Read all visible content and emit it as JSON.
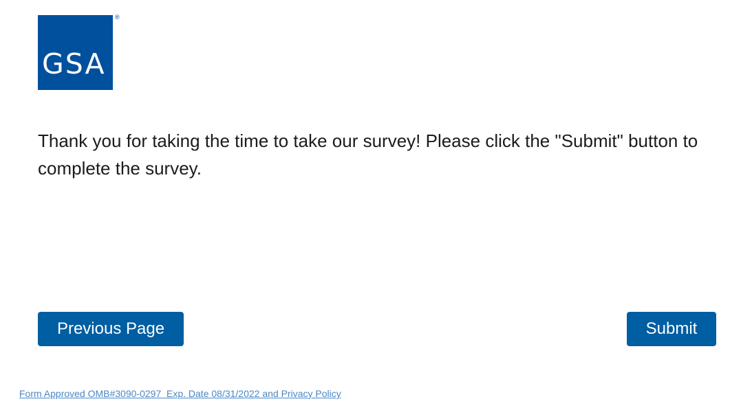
{
  "logo": {
    "text": "GSA",
    "registered_mark": "®",
    "brand_color": "#00509e"
  },
  "message": {
    "text": "Thank you for taking the time to take our survey!  Please click the \"Submit\" button to complete the survey."
  },
  "buttons": {
    "previous_label": "Previous Page",
    "submit_label": "Submit",
    "color": "#005ea2"
  },
  "footer": {
    "link_text": "Form Approved OMB#3090-0297  Exp. Date 08/31/2022 and Privacy Policy",
    "link_color": "#4a86c5"
  }
}
